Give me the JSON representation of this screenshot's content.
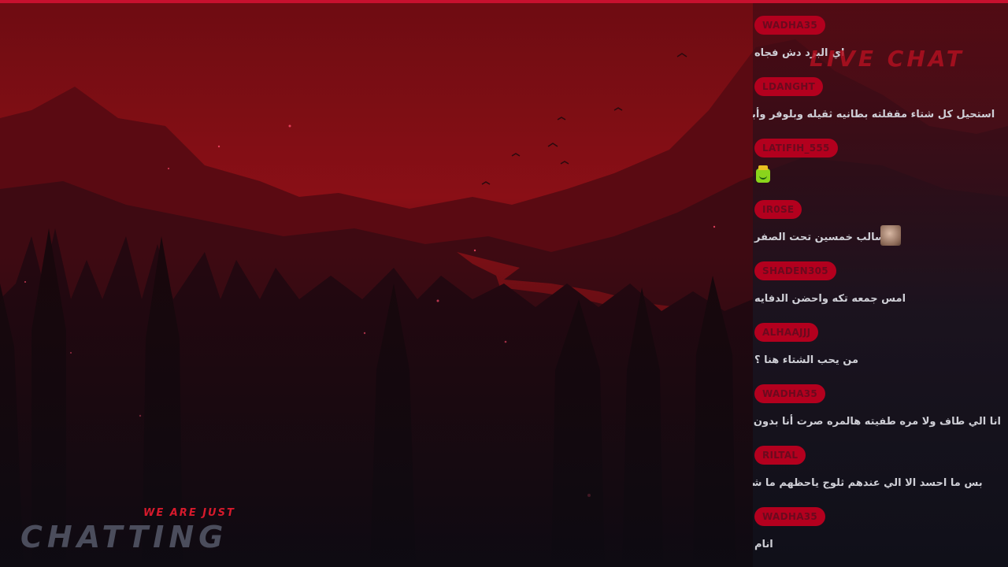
{
  "overlay": {
    "title": "LIVE CHAT",
    "tagline": "WE ARE JUST",
    "headline": "CHATTING"
  },
  "colors": {
    "accent": "#c8102e",
    "username_pill": "#b3001e",
    "username_text": "#6b0a1e",
    "message_text": "#cfcfd6",
    "panel_bg": "#12121c"
  },
  "chat": [
    {
      "username": "WADHA35",
      "message": "اي البرد دش فجاه"
    },
    {
      "username": "LDANGHT",
      "message": "استحيل كل شتاء مقفلته بطانيه ثقيله وبلوفر وأبرد بعد"
    },
    {
      "username": "LATIFIH_555",
      "message": "",
      "emote": "frog-crown-emote"
    },
    {
      "username": "IR0SE",
      "message": "سالب خمسين تحت الصفر",
      "avatar": "user-avatar-thumbnail"
    },
    {
      "username": "SHADEN305",
      "message": "امس جمعه تكه واحضن الدفايه"
    },
    {
      "username": "ALHAAJJJ",
      "message": "من يحب الشتاء هنا ؟"
    },
    {
      "username": "WADHA35",
      "message": "انا الي طاف ولا مره طفيته هالمره صرت أنا بدون مكيف"
    },
    {
      "username": "RILTAL",
      "message": "بس ما احسد الا الي عندهم ثلوج ياحظهم ما شاء الله"
    },
    {
      "username": "WADHA35",
      "message": "انام"
    }
  ]
}
